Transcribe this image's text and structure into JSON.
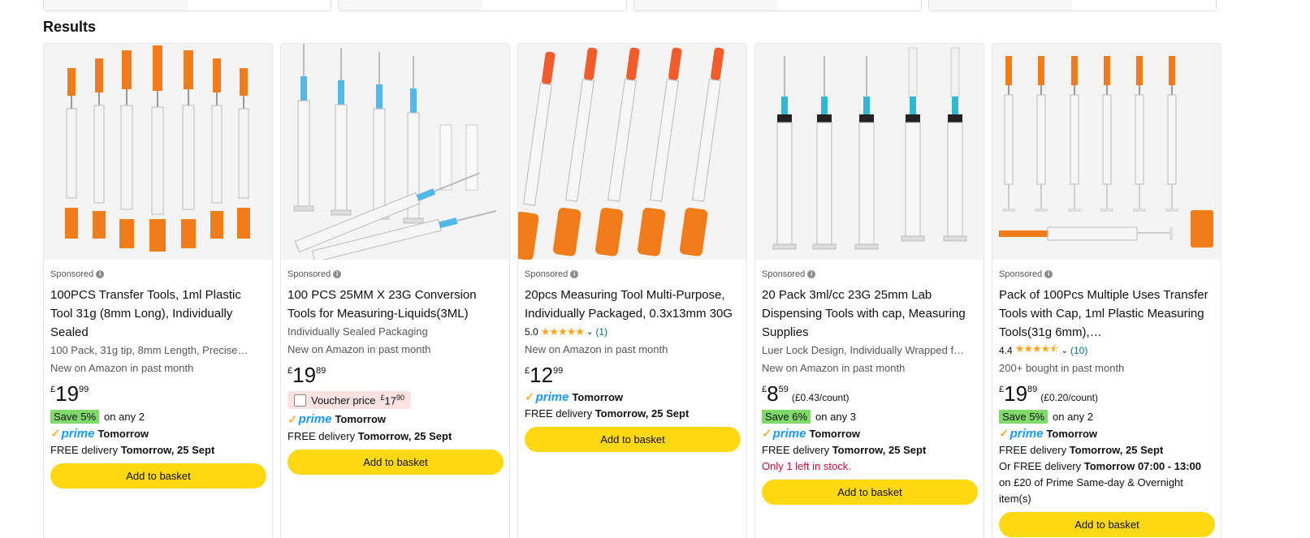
{
  "results_heading": "Results",
  "add_label": "Add to basket",
  "sponsored_label": "Sponsored",
  "colors": {
    "add_button": "#ffd814",
    "save_badge": "#7fda69",
    "prime_blue": "#1a98ff",
    "rating_link": "#007185",
    "stock_red": "#cc0c39"
  },
  "products": [
    {
      "title": "100PCS Transfer Tools, 1ml Plastic Tool 31g (8mm Long), Individually Sealed",
      "subtitle": "100 Pack, 31g tip, 8mm Length, Precise…",
      "badge": "New on Amazon in past month",
      "price_currency": "£",
      "price_whole": "19",
      "price_fraction": "99",
      "save_badge": "Save 5%",
      "save_text": "on any 2",
      "prime_text": "prime",
      "prime_day": "Tomorrow",
      "delivery_prefix": "FREE delivery ",
      "delivery_date": "Tomorrow, 25 Sept"
    },
    {
      "title": "100 PCS 25MM X 23G Conversion Tools for Measuring-Liquids(3ML)",
      "subtitle": "Individually Sealed Packaging",
      "badge": "New on Amazon in past month",
      "price_currency": "£",
      "price_whole": "19",
      "price_fraction": "89",
      "voucher_label": "Voucher price ",
      "voucher_currency": "£",
      "voucher_whole": "17",
      "voucher_fraction": "90",
      "prime_text": "prime",
      "prime_day": "Tomorrow",
      "delivery_prefix": "FREE delivery ",
      "delivery_date": "Tomorrow, 25 Sept"
    },
    {
      "title": "20pcs Measuring Tool Multi-Purpose, Individually Packaged, 0.3x13mm 30G",
      "rating": "5.0",
      "stars": "★★★★★",
      "rating_count": "(1)",
      "badge": "New on Amazon in past month",
      "price_currency": "£",
      "price_whole": "12",
      "price_fraction": "99",
      "prime_text": "prime",
      "prime_day": "Tomorrow",
      "delivery_prefix": "FREE delivery ",
      "delivery_date": "Tomorrow, 25 Sept"
    },
    {
      "title": "20 Pack 3ml/cc 23G 25mm Lab Dispensing Tools with cap, Measuring Supplies",
      "subtitle": "Luer Lock Design, Individually Wrapped f…",
      "badge": "New on Amazon in past month",
      "price_currency": "£",
      "price_whole": "8",
      "price_fraction": "59",
      "unit_price": "(£0.43/count)",
      "save_badge": "Save 6%",
      "save_text": "on any 3",
      "prime_text": "prime",
      "prime_day": "Tomorrow",
      "delivery_prefix": "FREE delivery ",
      "delivery_date": "Tomorrow, 25 Sept",
      "stock": "Only 1 left in stock."
    },
    {
      "title": "Pack of 100Pcs Multiple Uses Transfer Tools with Cap, 1ml Plastic Measuring Tools(31g 6mm),…",
      "rating": "4.4",
      "stars": "★★★★⯪",
      "rating_count": "(10)",
      "badge": "200+ bought in past month",
      "price_currency": "£",
      "price_whole": "19",
      "price_fraction": "89",
      "unit_price": "(£0.20/count)",
      "save_badge": "Save 5%",
      "save_text": "on any 2",
      "prime_text": "prime",
      "prime_day": "Tomorrow",
      "delivery_prefix": "FREE delivery ",
      "delivery_date": "Tomorrow, 25 Sept",
      "alt_delivery_prefix": "Or FREE delivery ",
      "alt_delivery_time": "Tomorrow 07:00 - 13:00",
      "alt_delivery_suffix": "on £20 of Prime Same-day & Overnight item(s)"
    }
  ]
}
